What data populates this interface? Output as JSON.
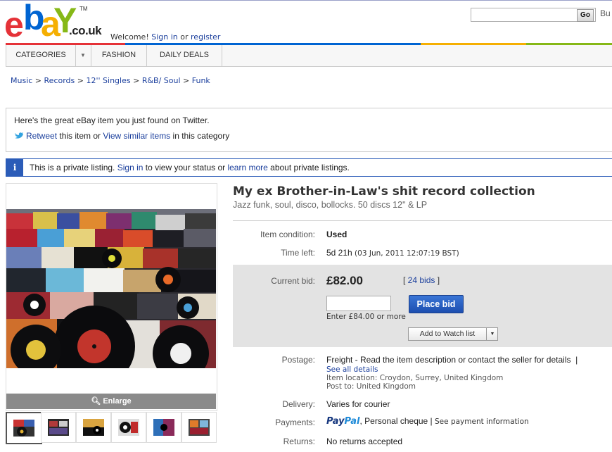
{
  "header": {
    "logo": {
      "e": "e",
      "b": "b",
      "a": "a",
      "y": "Y",
      "tld": ".co.uk",
      "tm": "TM",
      "colors": {
        "e": "#e53238",
        "b": "#0064d2",
        "a": "#f5af02",
        "y": "#86b817"
      }
    },
    "welcome": {
      "prefix": "Welcome! ",
      "sign_in": "Sign in",
      "or": " or ",
      "register": "register"
    },
    "search": {
      "go_label": "Go",
      "placeholder": ""
    },
    "buy_label": "Bu"
  },
  "nav": {
    "categories": "CATEGORIES",
    "fashion": "FASHION",
    "daily_deals": "DAILY DEALS"
  },
  "breadcrumb": [
    "Music",
    "Records",
    "12'' Singles",
    "R&B/ Soul",
    "Funk"
  ],
  "twitter": {
    "line1": "Here's the great eBay item you just found on Twitter.",
    "retweet": "Retweet",
    "mid": " this item or ",
    "similar": "View similar items",
    "end": " in this category"
  },
  "private_notice": {
    "icon": "i",
    "prefix": "This is a private listing. ",
    "sign_in": "Sign in",
    "mid": " to view your status or ",
    "learn_more": "learn more",
    "end": " about private listings."
  },
  "gallery": {
    "enlarge": "Enlarge",
    "thumb_count": 6
  },
  "listing": {
    "title": "My ex Brother-in-Law's shit record collection",
    "subtitle": "Jazz funk, soul, disco, bollocks. 50 discs 12\" & LP",
    "condition_label": "Item condition:",
    "condition": "Used",
    "time_left_label": "Time left:",
    "time_left": "5d 21h",
    "end_time": "(03 Jun, 2011 12:07:19 BST)",
    "current_bid_label": "Current bid:",
    "current_bid": "£82.00",
    "bids_open": "[ ",
    "bids": "24 bids",
    "bids_close": " ]",
    "place_bid": "Place bid",
    "enter_bid": "Enter £84.00 or more",
    "watch": "Add to Watch list",
    "postage_label": "Postage:",
    "postage": "Freight - Read the item description or contact the seller for details",
    "postage_bar": "|",
    "see_details": "See all details",
    "item_location": "Item location: Croydon, Surrey, United Kingdom",
    "post_to": "Post to: United Kingdom",
    "delivery_label": "Delivery:",
    "delivery": "Varies for courier",
    "payments_label": "Payments:",
    "paypal_1": "Pay",
    "paypal_2": "Pal",
    "payments_other": ", Personal cheque | ",
    "see_payment": "See payment information",
    "returns_label": "Returns:",
    "returns": "No returns accepted"
  },
  "colors": {
    "link": "#1a3e9c",
    "accent_blue": "#2b5cb8",
    "place_bid": "#2a64c8",
    "bid_panel": "#e3e3e3"
  }
}
